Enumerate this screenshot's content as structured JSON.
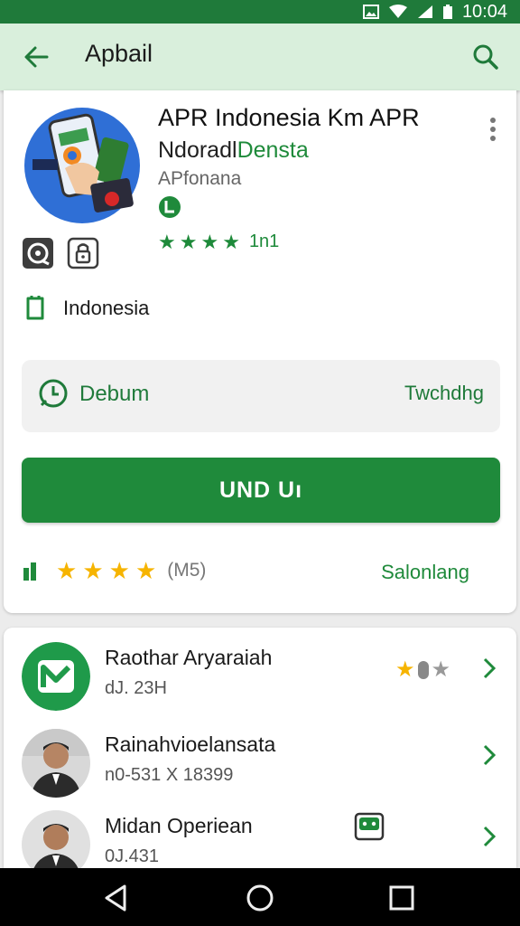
{
  "status_bar": {
    "time": "10:04",
    "icons": [
      "photo-icon",
      "wifi-icon",
      "signal-icon",
      "battery-icon"
    ]
  },
  "app_bar": {
    "title": "Apbail",
    "back_icon": "arrow-back-icon",
    "search_icon": "search-icon",
    "background": "#d9efdc",
    "accent": "#1f7a3a"
  },
  "app": {
    "title": "APR Indonesia Km APR",
    "developer_part1": "Ndorad",
    "developer_part2": "Densta",
    "developer_mid": "l",
    "category": "APfonana",
    "stars": 4,
    "rating_text": "1n1",
    "region": "Indonesia"
  },
  "info_box": {
    "left_label": "Debum",
    "right_label": "Twchdhg"
  },
  "install": {
    "label": "UND Uı",
    "color": "#1f8a3b"
  },
  "rating_row": {
    "stars": 4,
    "count": "(M5)",
    "link": "Salonlang"
  },
  "list": [
    {
      "title": "Raothar Aryaraiah",
      "subtitle": "dJ. 23H"
    },
    {
      "title": "Rainahvioelansata",
      "subtitle": "n0-531 X 18399"
    },
    {
      "title": "Midan Operiean",
      "subtitle": "0J.431"
    }
  ],
  "nav_bar": {
    "icons": [
      "back-triangle-icon",
      "home-circle-icon",
      "recents-square-icon"
    ]
  }
}
